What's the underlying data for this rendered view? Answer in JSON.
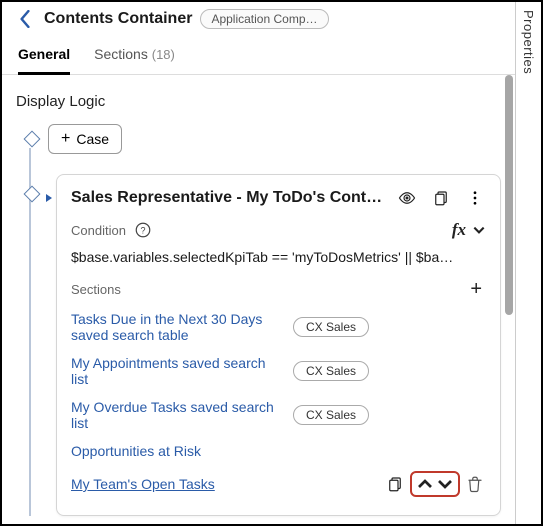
{
  "header": {
    "title": "Contents Container",
    "context_chip": "Application Comp…"
  },
  "tabs": {
    "items": [
      {
        "label": "General",
        "active": true
      },
      {
        "label": "Sections",
        "count": "(18)",
        "active": false
      }
    ]
  },
  "display_logic": {
    "title": "Display Logic",
    "add_case_label": "Case"
  },
  "case": {
    "title": "Sales Representative - My ToDo's Cont…",
    "condition_label": "Condition",
    "fx_label": "fx",
    "expression": "$base.variables.selectedKpiTab == 'myToDosMetrics' || $ba…",
    "sections_label": "Sections",
    "pill_label": "CX Sales",
    "sections": [
      {
        "name": "Tasks Due in the Next 30 Days saved search table",
        "has_pill": true,
        "link": false
      },
      {
        "name": "My Appointments saved search list",
        "has_pill": true,
        "link": false
      },
      {
        "name": "My Overdue Tasks saved search list",
        "has_pill": true,
        "link": false
      },
      {
        "name": "Opportunities at Risk",
        "has_pill": false,
        "link": false
      },
      {
        "name": "My Team's Open Tasks",
        "has_pill": false,
        "link": true,
        "selected": true
      }
    ]
  },
  "rail": {
    "label": "Properties"
  }
}
